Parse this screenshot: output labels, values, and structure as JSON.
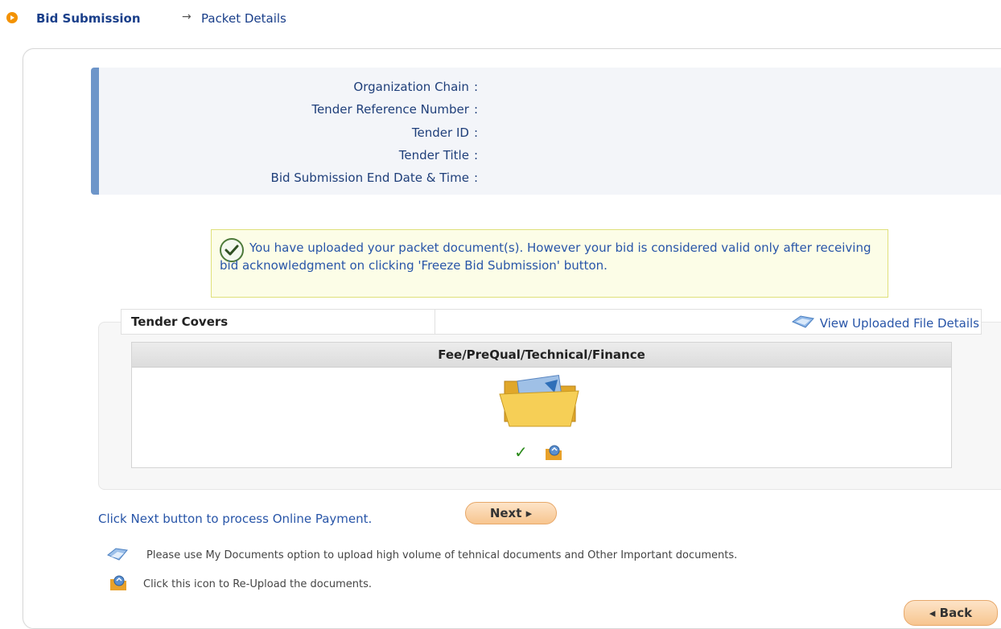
{
  "breadcrumb": {
    "parent": "Bid Submission",
    "separator": "→",
    "current": "Packet Details"
  },
  "info": {
    "organization_chain": "Organization Chain",
    "tender_reference_number": "Tender Reference Number",
    "tender_id": "Tender ID",
    "tender_title": "Tender Title",
    "bid_end_datetime": "Bid Submission End Date & Time",
    "colon": ":"
  },
  "notice": {
    "text": "You have uploaded your packet document(s). However your bid is considered valid only after receiving bid acknowledgment on clicking 'Freeze Bid Submission' button."
  },
  "covers": {
    "label": "Tender Covers",
    "view_link": "View Uploaded File Details",
    "column_header": "Fee/PreQual/Technical/Finance"
  },
  "actions": {
    "next_text": "Click Next button to process Online Payment.",
    "next_button": "Next ▸",
    "back_button": "◂ Back"
  },
  "notes": {
    "my_documents": "Please use My Documents option to upload high volume of tehnical documents and Other Important documents.",
    "reupload": "Click this icon to Re-Upload the documents."
  },
  "colors": {
    "link_blue": "#2855a8",
    "heading_blue": "#1a3f8a",
    "notice_bg": "#fcfde7",
    "button_orange": "#f7c58f"
  },
  "icons": [
    "breadcrumb-arrow-icon",
    "check-circle-icon",
    "view-details-icon",
    "folder-icon",
    "checkmark-icon",
    "reupload-icon",
    "documents-icon"
  ]
}
